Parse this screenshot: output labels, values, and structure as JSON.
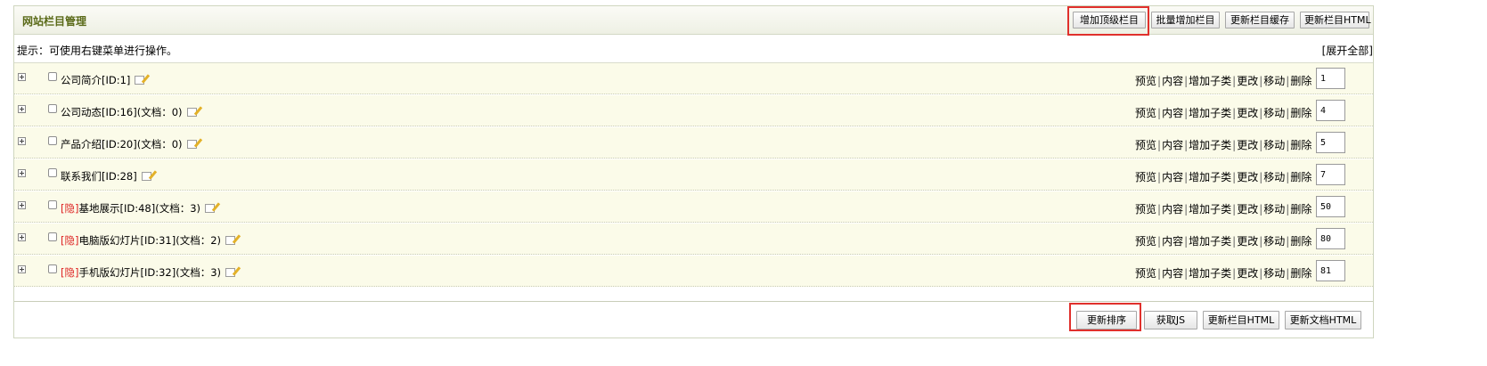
{
  "header": {
    "title": "网站栏目管理",
    "buttons": [
      "增加顶级栏目",
      "批量增加栏目",
      "更新栏目缓存",
      "更新栏目HTML"
    ]
  },
  "hint": {
    "text": "提示：可使用右键菜单进行操作。",
    "expand_all": "[展开全部]"
  },
  "ops": [
    "预览",
    "内容",
    "增加子类",
    "更改",
    "移动",
    "删除"
  ],
  "rows": [
    {
      "hidden_tag": "",
      "name": "公司简介",
      "info": "[ID:1]",
      "order": "1"
    },
    {
      "hidden_tag": "",
      "name": "公司动态",
      "info": "[ID:16](文档：0)",
      "order": "4"
    },
    {
      "hidden_tag": "",
      "name": "产品介绍",
      "info": "[ID:20](文档：0)",
      "order": "5"
    },
    {
      "hidden_tag": "",
      "name": "联系我们",
      "info": "[ID:28]",
      "order": "7"
    },
    {
      "hidden_tag": "[隐]",
      "name": "基地展示",
      "info": "[ID:48](文档：3)",
      "order": "50"
    },
    {
      "hidden_tag": "[隐]",
      "name": "电脑版幻灯片",
      "info": "[ID:31](文档：2)",
      "order": "80"
    },
    {
      "hidden_tag": "[隐]",
      "name": "手机版幻灯片",
      "info": "[ID:32](文档：3)",
      "order": "81"
    }
  ],
  "footer": {
    "buttons": [
      "更新排序",
      "获取JS",
      "更新栏目HTML",
      "更新文档HTML"
    ]
  },
  "colors": {
    "highlight": "#e0302c",
    "title": "#5a6a18",
    "row_bg": "#fbfbe9",
    "hidden_tag": "#dd2222"
  }
}
